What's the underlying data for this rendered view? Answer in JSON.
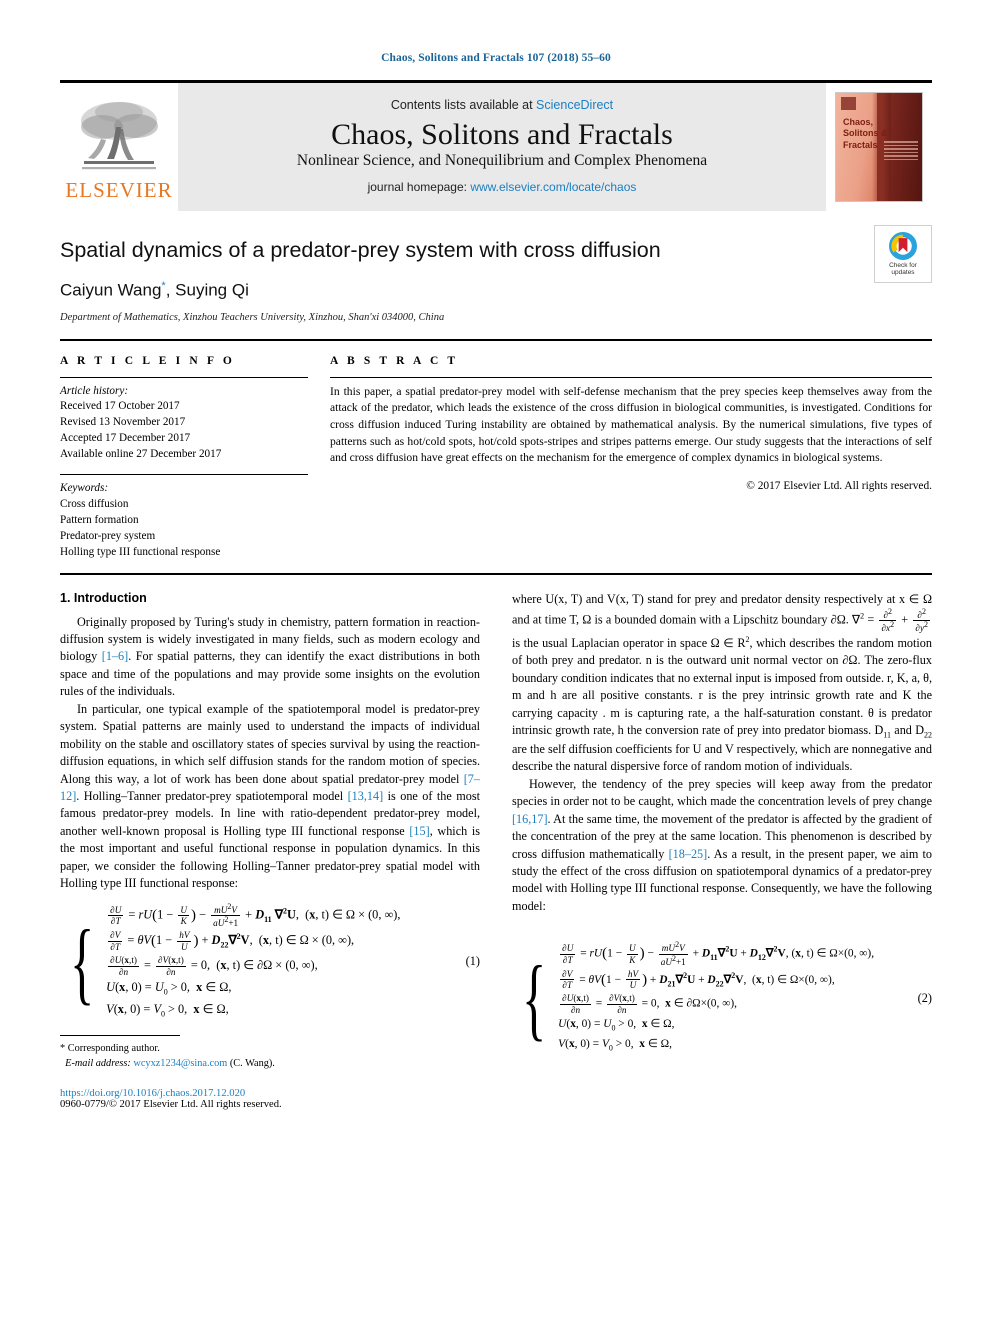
{
  "running_head": "Chaos, Solitons and Fractals 107 (2018) 55–60",
  "masthead": {
    "contents_prefix": "Contents lists available at ",
    "sciencedirect": "ScienceDirect",
    "journal_title": "Chaos, Solitons and Fractals",
    "journal_subtitle": "Nonlinear Science, and Nonequilibrium and Complex Phenomena",
    "homepage_prefix": "journal homepage: ",
    "homepage_url": "www.elsevier.com/locate/chaos",
    "publisher": "ELSEVIER",
    "cover_title": "Chaos, Solitons & Fractals",
    "accent_orange": "#E87722",
    "link_blue": "#1a7fc1"
  },
  "title_block": {
    "title": "Spatial dynamics of a predator-prey system with cross diffusion",
    "authors": "Caiyun Wang",
    "corresponding_mark": "*",
    "authors_rest": ", Suying Qi",
    "affiliation": "Department of Mathematics, Xinzhou Teachers University, Xinzhou, Shan'xi 034000, China",
    "crossmark_label_line1": "Check for",
    "crossmark_label_line2": "updates"
  },
  "article_info": {
    "heading": "A R T I C L E   I N F O",
    "history_label": "Article history:",
    "history": [
      "Received 17 October 2017",
      "Revised 13 November 2017",
      "Accepted 17 December 2017",
      "Available online 27 December 2017"
    ],
    "keywords_label": "Keywords:",
    "keywords": [
      "Cross diffusion",
      "Pattern formation",
      "Predator-prey system",
      "Holling type III functional response"
    ]
  },
  "abstract": {
    "heading": "A B S T R A C T",
    "text": "In this paper, a spatial predator-prey model with self-defense mechanism that the prey species keep themselves away from the attack of the predator, which leads the existence of the cross diffusion in biological communities, is investigated. Conditions for cross diffusion induced Turing instability are obtained by mathematical analysis. By the numerical simulations, five types of patterns such as hot/cold spots, hot/cold spots-stripes and stripes patterns emerge. Our study suggests that the interactions of self and cross diffusion have great effects on the mechanism for the emergence of complex dynamics in biological systems.",
    "copyright": "© 2017 Elsevier Ltd. All rights reserved."
  },
  "introduction": {
    "section_number_title": "1. Introduction",
    "para1_a": "Originally proposed by Turing's study in chemistry, pattern formation in reaction-diffusion system is widely investigated in many fields, such as modern ecology and biology ",
    "ref1": "[1–6]",
    "para1_b": ". For spatial patterns, they can identify the exact distributions in both space and time of the populations and may provide some insights on the evolution rules of the individuals.",
    "para2_a": "In particular, one typical example of the spatiotemporal model is predator-prey system. Spatial patterns are mainly used to understand the impacts of individual mobility on the stable and oscillatory states of species survival by using the reaction-diffusion equations, in which self diffusion stands for the random motion of species. Along this way, a lot of work has been done about spatial predator-prey model ",
    "ref2": "[7–12]",
    "para2_b": ". Holling–Tanner predator-prey spatiotemporal model ",
    "ref3": "[13,14]",
    "para2_c": " is one of the most famous predator-prey models. In line with ratio-dependent predator-prey model, another well-known proposal is Holling type III functional response ",
    "ref4": "[15]",
    "para2_d": ", which is the most important and useful functional response in population dynamics. In this paper, we consider the following Holling–Tanner predator-prey spatial model with Holling type III functional response:"
  },
  "right_column": {
    "para3_a": "where U(x, T) and V(x, T) stand for prey and predator density respectively at x ∈ Ω and at time T, Ω is a bounded domain with a Lipschitz boundary ∂Ω. ∇",
    "para3_b": " is the usual Laplacian operator in space Ω ∈ R",
    "para3_c": ", which describes the random motion of both prey and predator. n is the outward unit normal vector on ∂Ω. The zero-flux boundary condition indicates that no external input is imposed from outside. r, K, a, θ, m and h are all positive constants. r is the prey intrinsic growth rate and K the carrying capacity . m is capturing rate, a the half-saturation constant. θ is predator intrinsic growth rate, h the conversion rate of prey into predator biomass. D",
    "para3_d": " and D",
    "para3_e": " are the self diffusion coefficients for U and V respectively, which are nonnegative and describe the natural dispersive force of random motion of individuals.",
    "para4_a": "However, the tendency of the prey species will keep away from the predator species in order not to be caught, which made the concentration levels of prey change ",
    "ref5": "[16,17]",
    "para4_b": ". At the same time, the movement of the predator is affected by the gradient of the concentration of the prey at the same location. This phenomenon is described by cross diffusion mathematically ",
    "ref6": "[18–25]",
    "para4_c": ". As a result, in the present paper, we aim to study the effect of the cross diffusion on spatiotemporal dynamics of a predator-prey model with Holling type III functional response. Consequently, we have the following model:"
  },
  "equation1": {
    "number": "(1)",
    "lines": [
      "∂U/∂T = rU(1 − U/K) − mU²V/(aU²+1) + D11∇²U,  (x, t) ∈ Ω × (0, ∞),",
      "∂V/∂T = θV(1 − hV/U) + D22∇²V,  (x, t) ∈ Ω × (0, ∞),",
      "∂U(x,t)/∂n = ∂V(x,t)/∂n = 0,  (x, t) ∈ ∂Ω × (0, ∞),",
      "U(x, 0) = U0 > 0,  x ∈ Ω,",
      "V(x, 0) = V0 > 0,  x ∈ Ω,"
    ]
  },
  "equation2": {
    "number": "(2)",
    "lines": [
      "∂U/∂T = rU(1 − U/K) − mU²V/(aU²+1) + D11∇²U + D12∇²V, (x, t) ∈ Ω×(0, ∞),",
      "∂V/∂T = θV(1 − hV/U) + D21∇²U + D22∇²V,  (x, t) ∈ Ω×(0, ∞),",
      "∂U(x,t)/∂n = ∂V(x,t)/∂n = 0,  x ∈ ∂Ω×(0, ∞),",
      "U(x, 0) = U0 > 0,  x ∈ Ω,",
      "V(x, 0) = V0 > 0,  x ∈ Ω,"
    ]
  },
  "footnote": {
    "corresponding": "* Corresponding author.",
    "email_label": "E-mail address:",
    "email": "wcyxz1234@sina.com",
    "email_suffix": "(C. Wang).",
    "doi": "https://doi.org/10.1016/j.chaos.2017.12.020",
    "issn_copyright": "0960-0779/© 2017 Elsevier Ltd. All rights reserved."
  }
}
